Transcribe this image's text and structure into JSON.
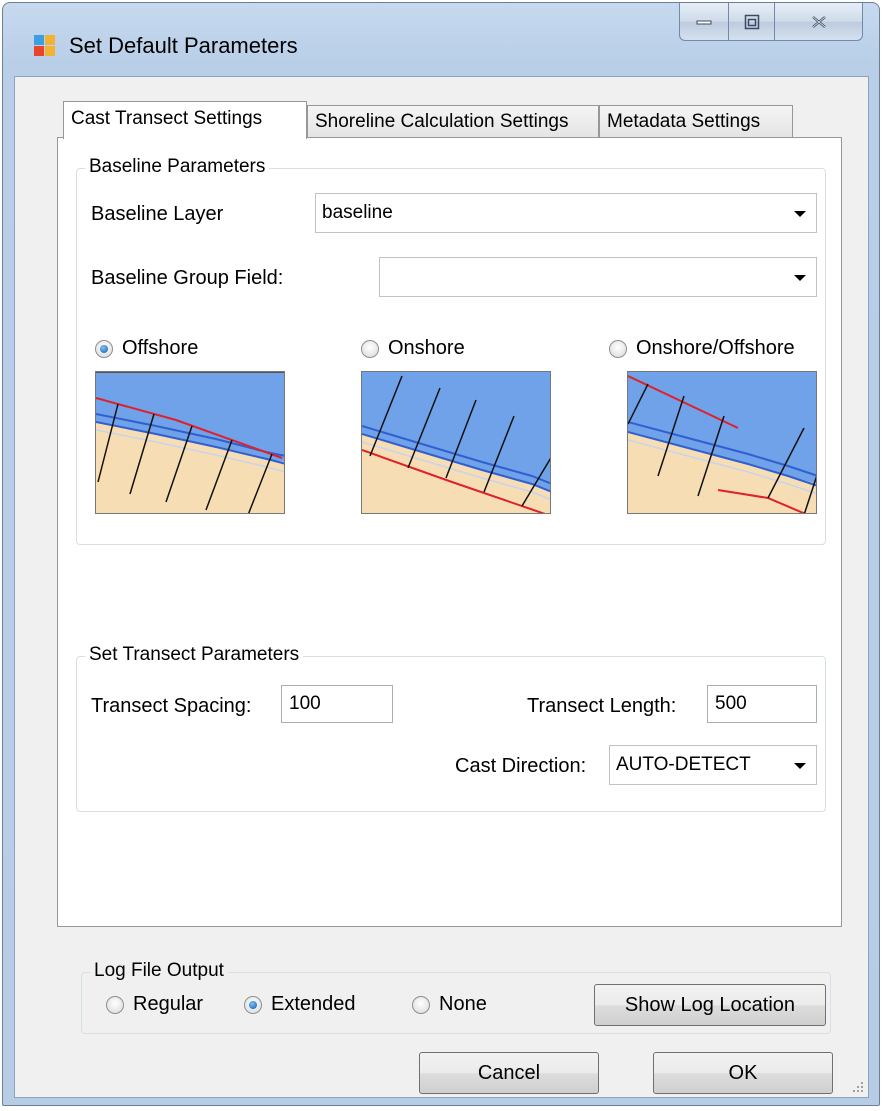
{
  "window": {
    "title": "Set Default Parameters"
  },
  "tabs": [
    {
      "label": "Cast Transect Settings",
      "active": true
    },
    {
      "label": "Shoreline Calculation Settings",
      "active": false
    },
    {
      "label": "Metadata Settings",
      "active": false
    }
  ],
  "baseline": {
    "group_label": "Baseline Parameters",
    "layer_label": "Baseline Layer",
    "layer_value": "baseline",
    "group_field_label": "Baseline Group Field:",
    "group_field_value": "",
    "options": [
      {
        "label": "Offshore",
        "selected": true
      },
      {
        "label": "Onshore",
        "selected": false
      },
      {
        "label": "Onshore/Offshore",
        "selected": false
      }
    ]
  },
  "transect": {
    "group_label": "Set Transect Parameters",
    "spacing_label": "Transect Spacing:",
    "spacing_value": "100",
    "length_label": "Transect Length:",
    "length_value": "500",
    "direction_label": "Cast Direction:",
    "direction_value": "AUTO-DETECT"
  },
  "log": {
    "group_label": "Log File Output",
    "options": [
      {
        "label": "Regular",
        "selected": false
      },
      {
        "label": "Extended",
        "selected": true
      },
      {
        "label": "None",
        "selected": false
      }
    ],
    "show_location_label": "Show Log Location"
  },
  "buttons": {
    "cancel": "Cancel",
    "ok": "OK"
  },
  "colors": {
    "water": "#6fa2e8",
    "land": "#f7ddb3",
    "baseline_red": "#e0202a",
    "shoreline_blue": "#2f5fd0",
    "transect_black": "#111111"
  }
}
